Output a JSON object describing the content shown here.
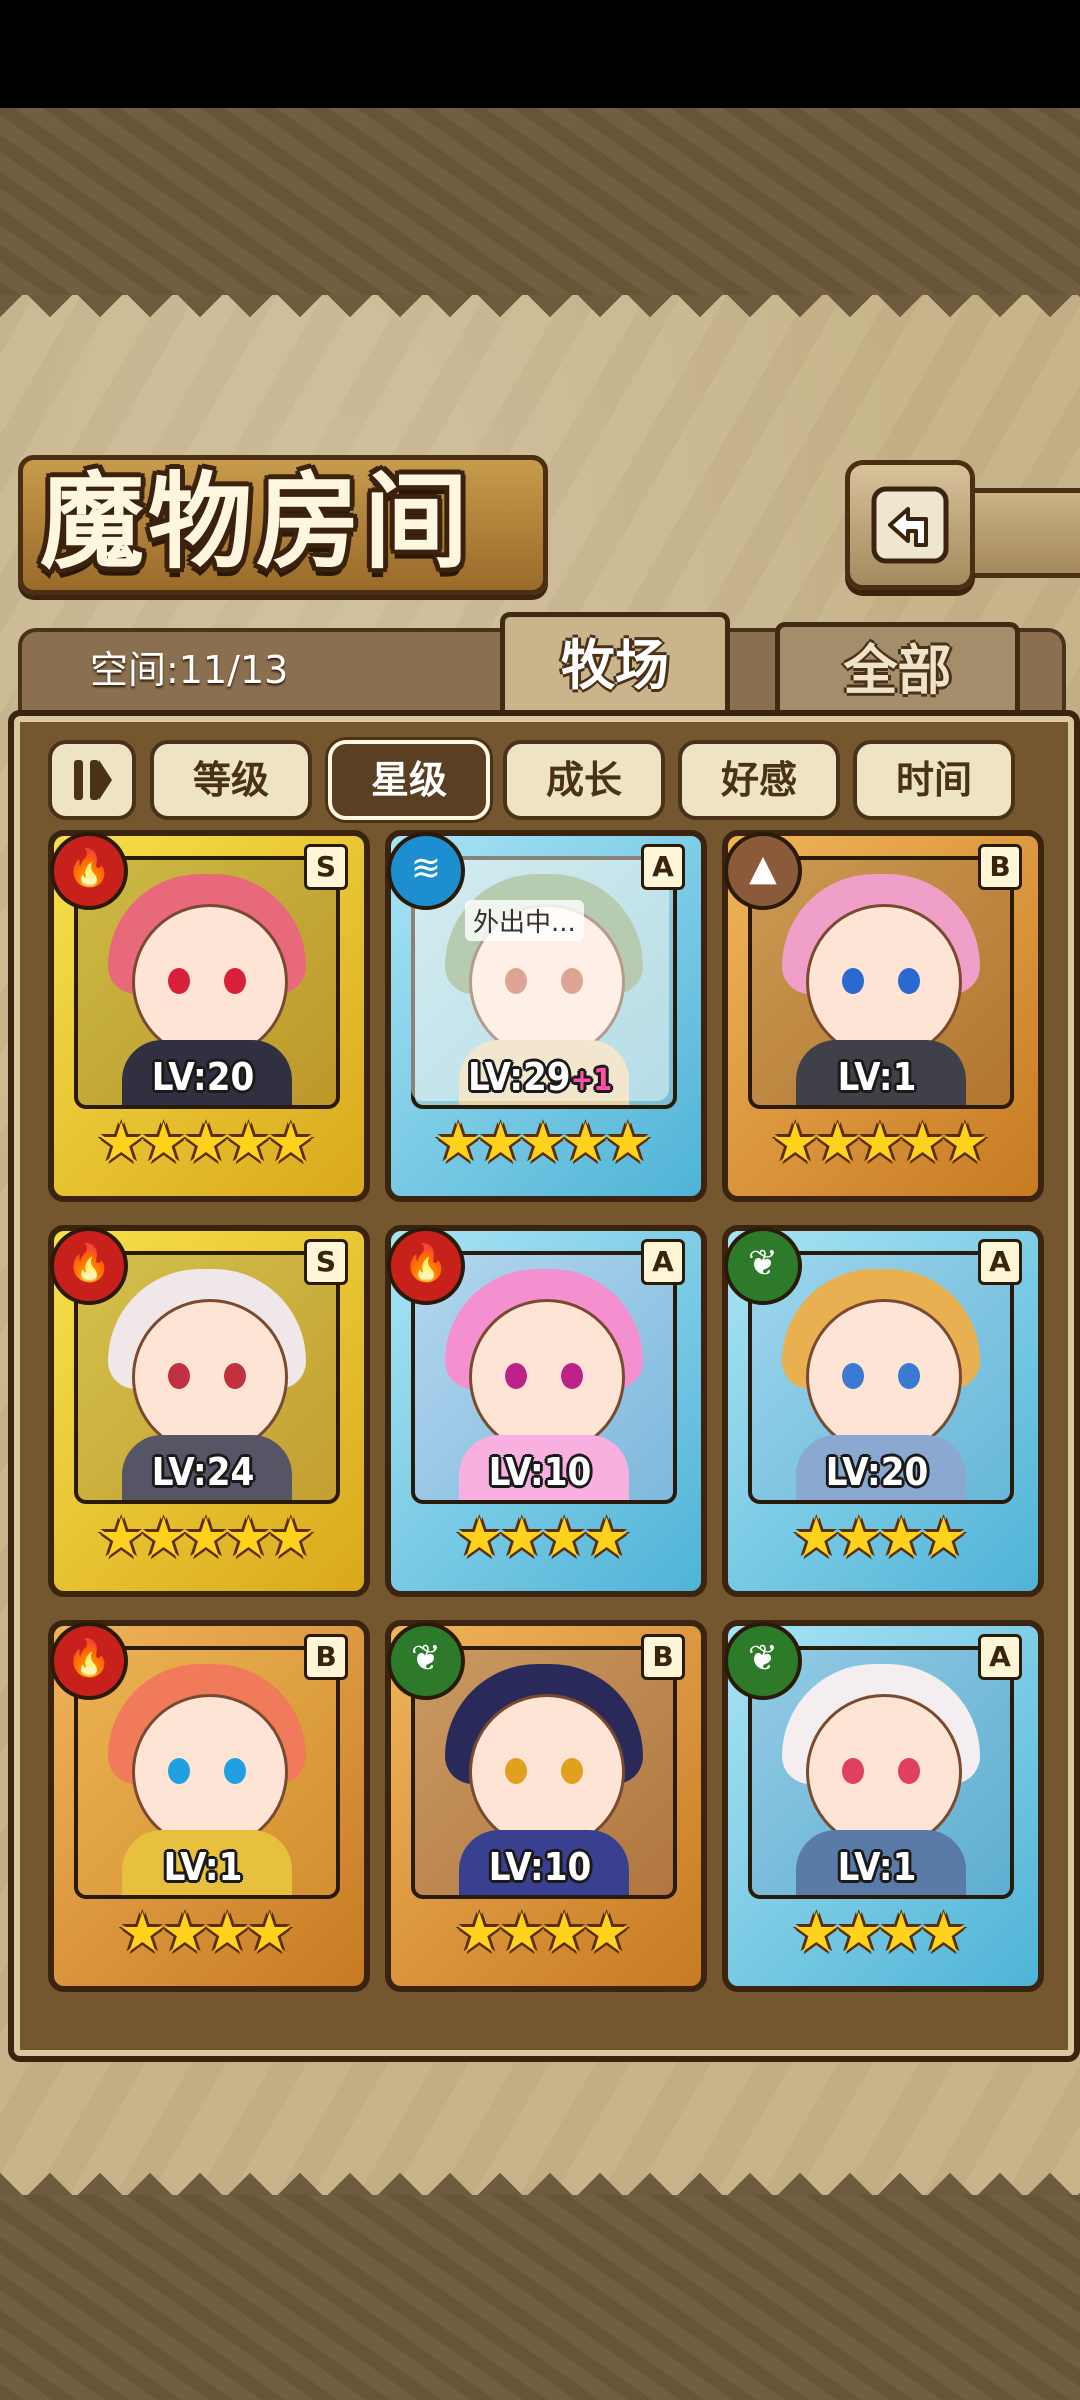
{
  "screen": {
    "title": "魔物房间",
    "capacity": "空间:11/13"
  },
  "tabs": [
    {
      "label": "牧场",
      "active": true
    },
    {
      "label": "全部",
      "active": false
    }
  ],
  "sort_buttons": [
    {
      "label": "等级",
      "active": false
    },
    {
      "label": "星级",
      "active": true
    },
    {
      "label": "成长",
      "active": false
    },
    {
      "label": "好感",
      "active": false
    },
    {
      "label": "时间",
      "active": false
    }
  ],
  "monsters": [
    {
      "element": "fire",
      "rank": "S",
      "level": "LV:20",
      "bonus": "",
      "stars": 5,
      "status": "",
      "hair": "#e86a7a",
      "eyes": "#d8203a",
      "outfit": "#303040"
    },
    {
      "element": "water",
      "rank": "A",
      "level": "LV:29",
      "bonus": "+1",
      "stars": 5,
      "status": "外出中...",
      "hair": "#7aa070",
      "eyes": "#c05a3a",
      "outfit": "#e8d2a8"
    },
    {
      "element": "earth",
      "rank": "B",
      "level": "LV:1",
      "bonus": "",
      "stars": 5,
      "status": "",
      "hair": "#f0a0c8",
      "eyes": "#2a6ad0",
      "outfit": "#404048"
    },
    {
      "element": "fire",
      "rank": "S",
      "level": "LV:24",
      "bonus": "",
      "stars": 5,
      "status": "",
      "hair": "#f0e8e8",
      "eyes": "#c03040",
      "outfit": "#555566"
    },
    {
      "element": "fire",
      "rank": "A",
      "level": "LV:10",
      "bonus": "",
      "stars": 4,
      "status": "",
      "hair": "#f590d0",
      "eyes": "#c0208a",
      "outfit": "#f8b0e0"
    },
    {
      "element": "wood",
      "rank": "A",
      "level": "LV:20",
      "bonus": "",
      "stars": 4,
      "status": "",
      "hair": "#e8b050",
      "eyes": "#3a7ad0",
      "outfit": "#8aa8d0"
    },
    {
      "element": "fire",
      "rank": "B",
      "level": "LV:1",
      "bonus": "",
      "stars": 4,
      "status": "",
      "hair": "#f07a5a",
      "eyes": "#20a0e0",
      "outfit": "#e8c040"
    },
    {
      "element": "wood",
      "rank": "B",
      "level": "LV:10",
      "bonus": "",
      "stars": 4,
      "status": "",
      "hair": "#2a2a5a",
      "eyes": "#e0a020",
      "outfit": "#3a4090"
    },
    {
      "element": "wood",
      "rank": "A",
      "level": "LV:1",
      "bonus": "",
      "stars": 4,
      "status": "",
      "hair": "#f4eef0",
      "eyes": "#e04060",
      "outfit": "#5a7aa8"
    }
  ]
}
